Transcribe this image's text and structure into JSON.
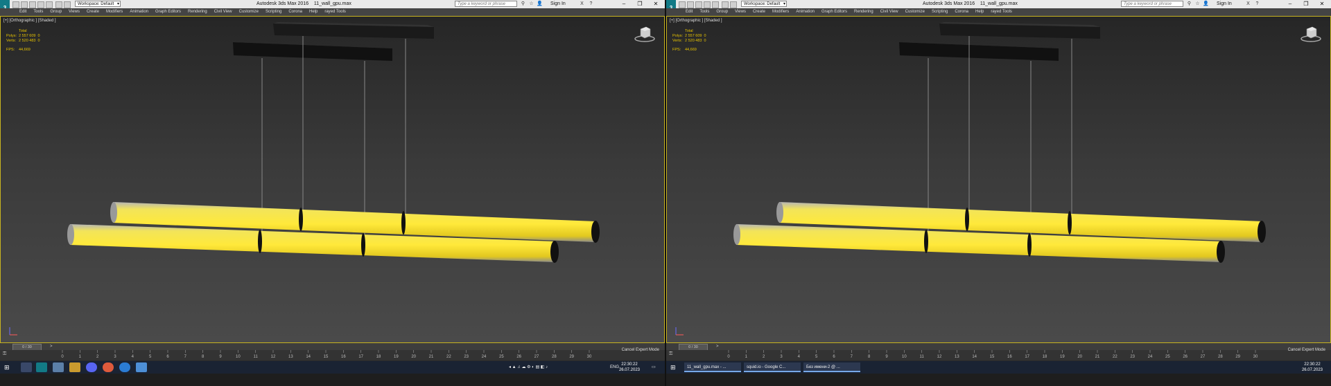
{
  "app": {
    "title": "Autodesk 3ds Max 2016",
    "file": "11_wall_gpu.max",
    "workspace": "Workspace: Default",
    "search_placeholder": "Type a keyword or phrase",
    "sign_in": "Sign In"
  },
  "menu": [
    "Edit",
    "Tools",
    "Group",
    "Views",
    "Create",
    "Modifiers",
    "Animation",
    "Graph Editors",
    "Rendering",
    "Civil View",
    "Customize",
    "Scripting",
    "Corona",
    "Help",
    "rayed Tools"
  ],
  "viewport": {
    "label": "[+] [Orthographic ] [Shaded ]",
    "stats": {
      "total_label": "Total",
      "polys_label": "Polys:",
      "polys": "2 557 609",
      "polys_sel": "0",
      "verts_label": "Verts:",
      "verts": "2 520 483",
      "verts_sel": "0",
      "fps_label": "FPS:",
      "fps": "44,669"
    },
    "accent": "#e6c300",
    "border": "#c8b420"
  },
  "timeline": {
    "position": "0 / 30",
    "ticks": [
      "0",
      "1",
      "2",
      "3",
      "4",
      "5",
      "6",
      "7",
      "8",
      "9",
      "10",
      "11",
      "12",
      "13",
      "14",
      "15",
      "16",
      "17",
      "18",
      "19",
      "20",
      "21",
      "22",
      "23",
      "24",
      "25",
      "26",
      "27",
      "28",
      "29",
      "30"
    ],
    "expert_mode": "Cancel Expert Mode"
  },
  "taskbar_left": {
    "lang": "ENG",
    "time": "22:30:22",
    "date": "26.07.2023"
  },
  "taskbar_right": {
    "items": [
      "11_wall_gpu.max - ...",
      "squid.io - Google C...",
      "Без имени-2 @ ..."
    ],
    "time": "22:30:22",
    "date": "26.07.2023"
  }
}
